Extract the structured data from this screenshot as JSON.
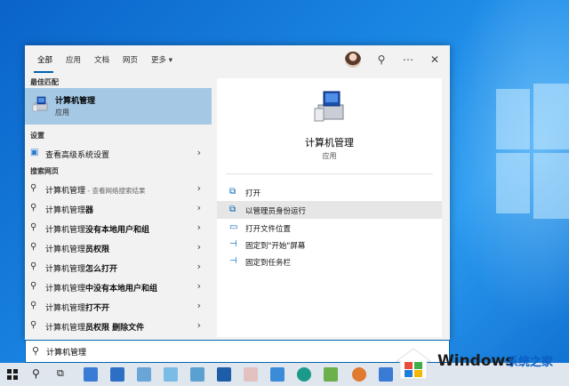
{
  "tabs": [
    {
      "label": "全部",
      "active": true
    },
    {
      "label": "应用"
    },
    {
      "label": "文档"
    },
    {
      "label": "网页"
    },
    {
      "label": "更多 ▾"
    }
  ],
  "header_icons": [
    "avatar",
    "feedback-icon",
    "more-icon",
    "close-icon"
  ],
  "sections": {
    "best_match": "最佳匹配",
    "settings": "设置",
    "web": "搜索网页"
  },
  "best_match": {
    "title": "计算机管理",
    "subtitle": "应用"
  },
  "settings_items": [
    {
      "label": "查看高级系统设置"
    }
  ],
  "web_items": [
    {
      "prefix": "计算机管理",
      "bold": "",
      "dim": " - 查看网络搜索结果"
    },
    {
      "prefix": "计算机管理",
      "bold": "器",
      "dim": ""
    },
    {
      "prefix": "计算机管理",
      "bold": "没有本地用户和组",
      "dim": ""
    },
    {
      "prefix": "计算机管理",
      "bold": "员权限",
      "dim": ""
    },
    {
      "prefix": "计算机管理",
      "bold": "怎么打开",
      "dim": ""
    },
    {
      "prefix": "计算机管理",
      "bold": "中没有本地用户和组",
      "dim": ""
    },
    {
      "prefix": "计算机管理",
      "bold": "打不开",
      "dim": ""
    },
    {
      "prefix": "计算机管理",
      "bold": "员权限 删除文件",
      "dim": ""
    }
  ],
  "detail": {
    "title": "计算机管理",
    "subtitle": "应用",
    "actions": [
      {
        "label": "打开",
        "icon": "open-icon"
      },
      {
        "label": "以管理员身份运行",
        "icon": "run-as-admin-icon",
        "highlighted": true
      },
      {
        "label": "打开文件位置",
        "icon": "file-location-icon"
      },
      {
        "label": "固定到\"开始\"屏幕",
        "icon": "pin-start-icon"
      },
      {
        "label": "固定到任务栏",
        "icon": "pin-taskbar-icon"
      }
    ]
  },
  "search": {
    "value": "计算机管理"
  },
  "watermark": {
    "brand": "Windows",
    "site": "系统之家"
  },
  "colors": {
    "accent": "#0063b1",
    "selected": "#a5c8e4"
  }
}
